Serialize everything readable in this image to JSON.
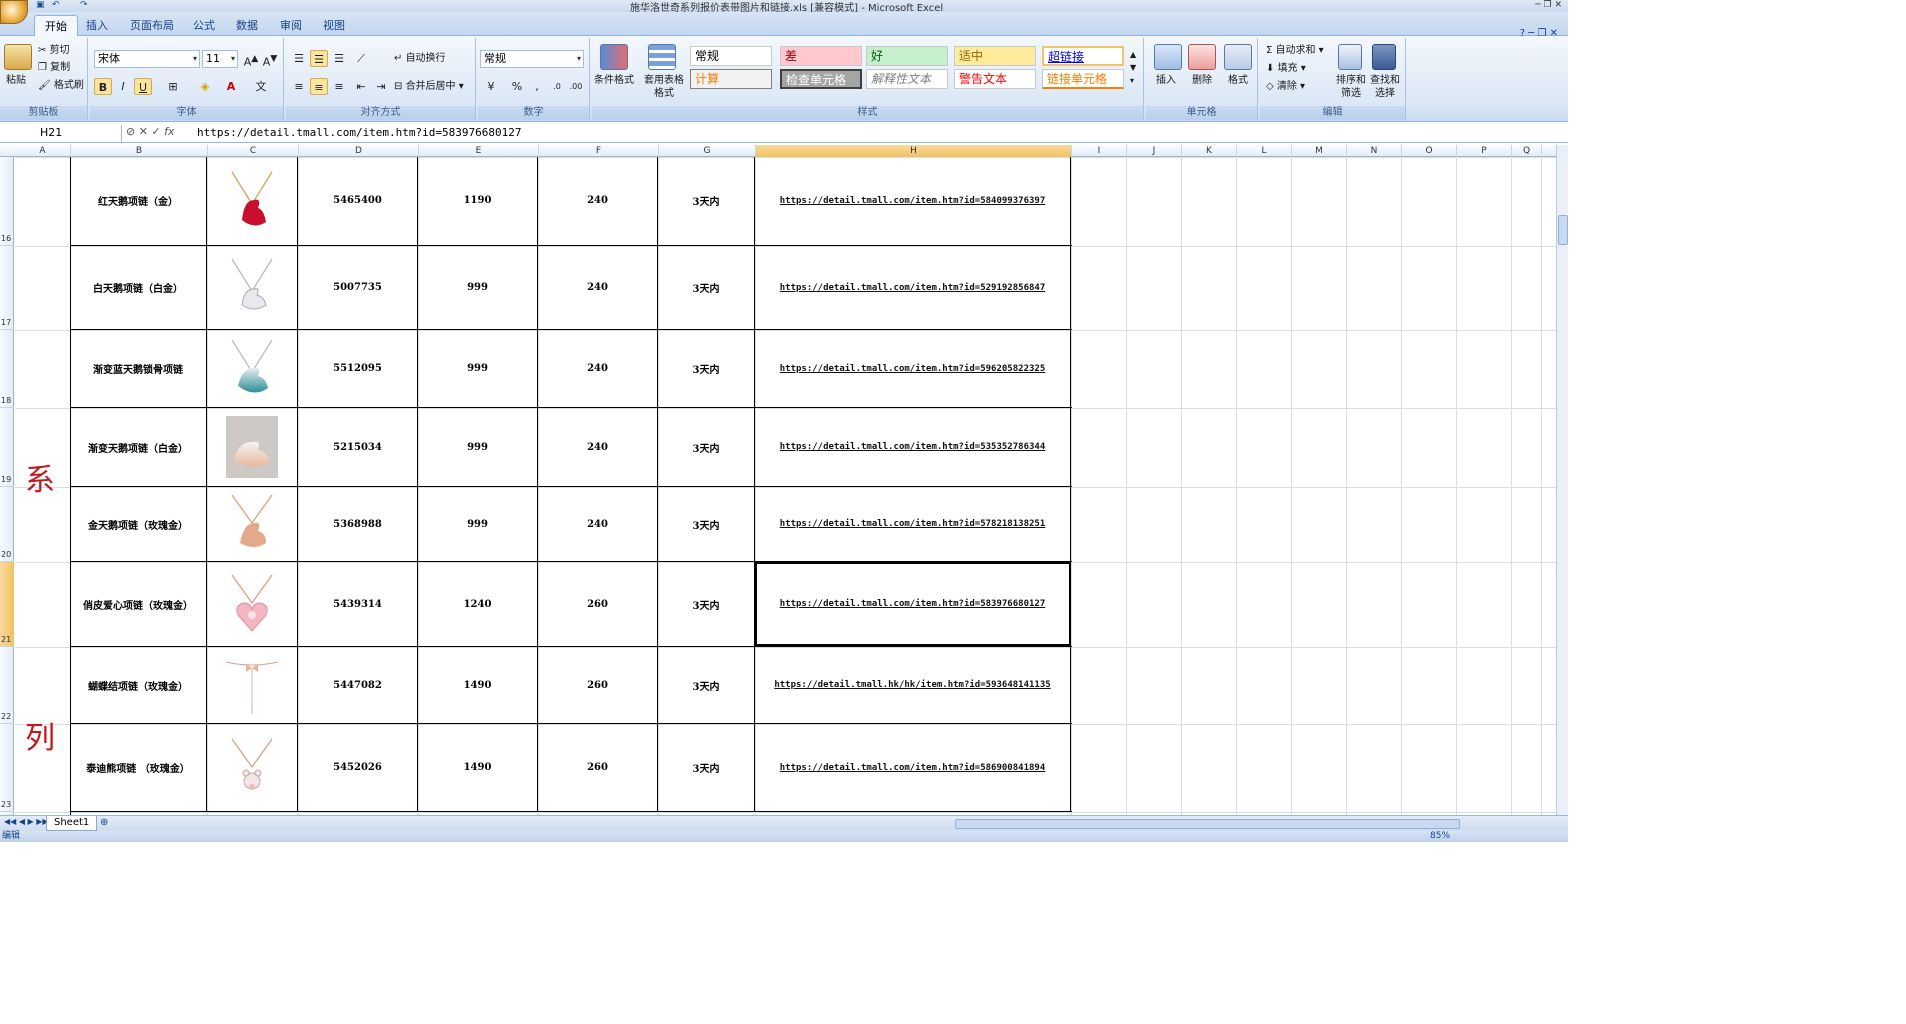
{
  "window": {
    "title": "施华洛世奇系列报价表带图片和链接.xls [兼容模式] - Microsoft Excel"
  },
  "tabs": [
    "开始",
    "插入",
    "页面布局",
    "公式",
    "数据",
    "审阅",
    "视图"
  ],
  "ribbon": {
    "clipboard": {
      "paste": "粘贴",
      "cut": "剪切",
      "copy": "复制",
      "format_painter": "格式刷",
      "label": "剪贴板"
    },
    "font": {
      "font_name": "宋体",
      "font_size": "11",
      "bold": "B",
      "italic": "I",
      "underline": "U",
      "label": "字体"
    },
    "alignment": {
      "wrap": "自动换行",
      "merge": "合并后居中",
      "label": "对齐方式"
    },
    "number": {
      "format": "常规",
      "percent": "%",
      "comma": ",",
      "label": "数字"
    },
    "styles": {
      "conditional": "条件格式",
      "table_format": "套用表格格式",
      "cells": [
        "常规",
        "差",
        "好",
        "适中",
        "超链接",
        "计算",
        "检查单元格",
        "解释性文本",
        "警告文本",
        "链接单元格"
      ],
      "label": "样式"
    },
    "cells": {
      "insert": "插入",
      "delete": "删除",
      "format": "格式",
      "label": "单元格"
    },
    "editing": {
      "autosum": "自动求和",
      "fill": "填充",
      "clear": "清除",
      "sort": "排序和筛选",
      "find": "查找和选择",
      "label": "编辑"
    }
  },
  "formula_bar": {
    "name_box": "H21",
    "formula": "https://detail.tmall.com/item.htm?id=583976680127"
  },
  "columns": [
    "A",
    "B",
    "C",
    "D",
    "E",
    "F",
    "G",
    "H",
    "I",
    "J",
    "K",
    "L",
    "M",
    "N",
    "O",
    "P",
    "Q"
  ],
  "selected_column": "H",
  "selected_row": "21",
  "side_chars": [
    "系",
    "列"
  ],
  "rows": [
    {
      "row": "16",
      "name": "红天鹅项链（金）",
      "code": "5465400",
      "price": "1190",
      "deposit": "240",
      "ship": "3天内",
      "link": "https://detail.tmall.com/item.htm?id=584099376397",
      "pic": "red-swan"
    },
    {
      "row": "17",
      "name": "白天鹅项链（白金）",
      "code": "5007735",
      "price": "999",
      "deposit": "240",
      "ship": "3天内",
      "link": "https://detail.tmall.com/item.htm?id=529192856847",
      "pic": "white-swan"
    },
    {
      "row": "18",
      "name": "渐变蓝天鹅锁骨项链",
      "code": "5512095",
      "price": "999",
      "deposit": "240",
      "ship": "3天内",
      "link": "https://detail.tmall.com/item.htm?id=596205822325",
      "pic": "blue-swan"
    },
    {
      "row": "19",
      "name": "渐变天鹅项链（白金）",
      "code": "5215034",
      "price": "999",
      "deposit": "240",
      "ship": "3天内",
      "link": "https://detail.tmall.com/item.htm?id=535352786344",
      "pic": "gradient-swan"
    },
    {
      "row": "20",
      "name": "金天鹅项链（玫瑰金）",
      "code": "5368988",
      "price": "999",
      "deposit": "240",
      "ship": "3天内",
      "link": "https://detail.tmall.com/item.htm?id=578218138251",
      "pic": "rose-swan"
    },
    {
      "row": "21",
      "name": "俏皮爱心项链（玫瑰金）",
      "code": "5439314",
      "price": "1240",
      "deposit": "260",
      "ship": "3天内",
      "link": "https://detail.tmall.com/item.htm?id=583976680127",
      "pic": "heart"
    },
    {
      "row": "22",
      "name": "蝴蝶结项链（玫瑰金）",
      "code": "5447082",
      "price": "1490",
      "deposit": "260",
      "ship": "3天内",
      "link": "https://detail.tmall.hk/hk/item.htm?id=593648141135",
      "pic": "bow"
    },
    {
      "row": "23",
      "name": "泰迪熊项链 （玫瑰金）",
      "code": "5452026",
      "price": "1490",
      "deposit": "260",
      "ship": "3天内",
      "link": "https://detail.tmall.com/item.htm?id=586900841894",
      "pic": "teddy"
    }
  ],
  "sheet_tab": "Sheet1",
  "status": {
    "mode": "编辑",
    "zoom": "85%"
  }
}
